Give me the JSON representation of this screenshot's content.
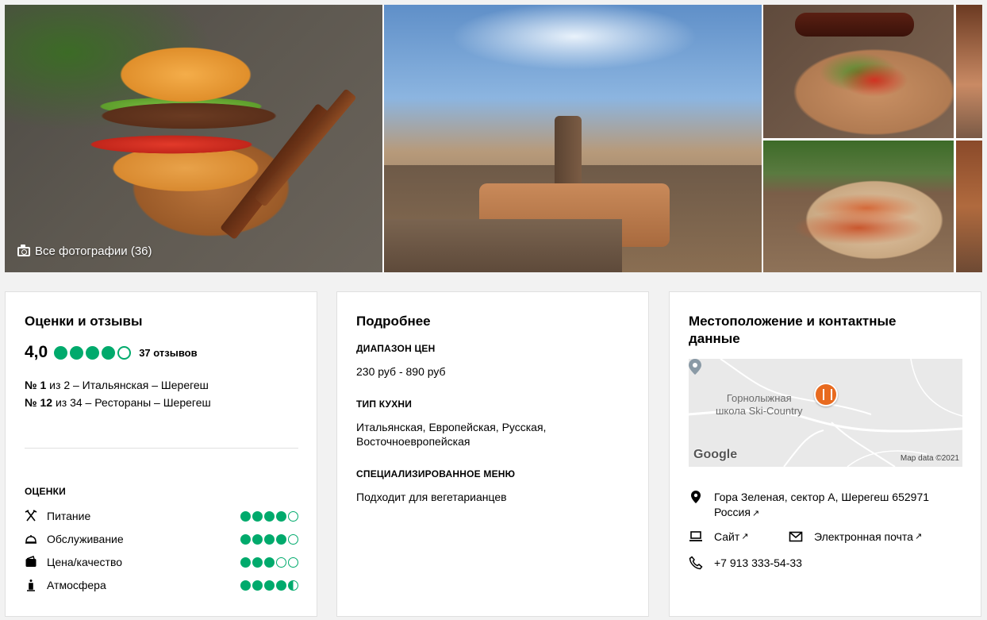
{
  "gallery": {
    "all_photos_label": "Все фотографии (36)"
  },
  "reviews": {
    "title": "Оценки и отзывы",
    "rating": "4,0",
    "rating_value": 4.0,
    "reviews_count": "37 отзывов",
    "rankings": [
      {
        "place": "№ 1",
        "text": " из 2 – Итальянская – Шерегеш"
      },
      {
        "place": "№ 12",
        "text": " из 34 – Рестораны – Шерегеш"
      }
    ],
    "ratings_header": "ОЦЕНКИ",
    "categories": [
      {
        "label": "Питание",
        "icon": "food-icon",
        "value": 4.0
      },
      {
        "label": "Обслуживание",
        "icon": "service-icon",
        "value": 4.0
      },
      {
        "label": "Цена/качество",
        "icon": "wallet-icon",
        "value": 3.0
      },
      {
        "label": "Атмосфера",
        "icon": "atmosphere-icon",
        "value": 4.5
      }
    ],
    "accent_color": "#00aa6c"
  },
  "details": {
    "title": "Подробнее",
    "price_header": "ДИАПАЗОН ЦЕН",
    "price_value": "230 руб - 890 руб",
    "cuisine_header": "ТИП КУХНИ",
    "cuisine_value": "Итальянская, Европейская, Русская, Восточноевропейская",
    "menu_header": "СПЕЦИАЛИЗИРОВАННОЕ МЕНЮ",
    "menu_value": "Подходит для вегетарианцев"
  },
  "location": {
    "title": "Местоположение и контактные данные",
    "map_label_line1": "Горнолыжная",
    "map_label_line2": "школа Ski-Country",
    "map_brand": "Google",
    "map_data": "Map data ©2021",
    "address_line1": "Гора Зеленая, сектор А, Шерегеш 652971",
    "address_line2": "Россия",
    "website_label": "Сайт",
    "email_label": "Электронная почта",
    "phone": "+7 913 333-54-33",
    "arrow_glyph": "↗"
  }
}
